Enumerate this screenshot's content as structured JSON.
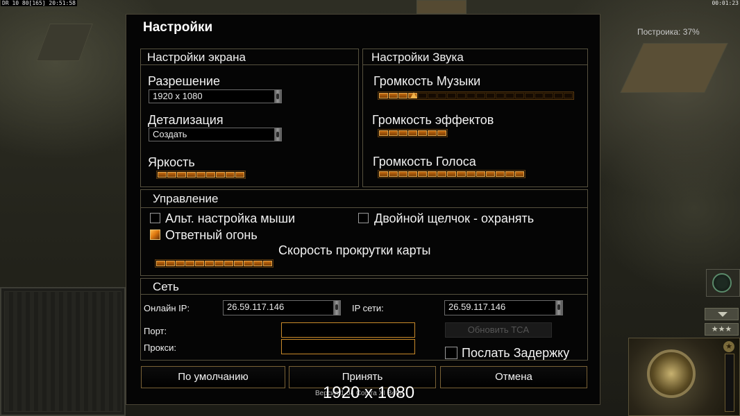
{
  "hud": {
    "top_left": "DR 10 80[165] 20:51:58",
    "top_right": "00:01:23",
    "fps_badge": "Построика: 37%"
  },
  "dialog": {
    "title": "Настройки",
    "display": {
      "title": "Настройки экрана",
      "resolution_label": "Разрешение",
      "resolution_value": "1920 x 1080",
      "detail_label": "Детализация",
      "detail_value": "Создать",
      "brightness_label": "Яркость",
      "brightness_level": 9,
      "brightness_total": 9
    },
    "sound": {
      "title": "Настройки Звука",
      "music_label": "Громкость Музыки",
      "music_level": 4,
      "music_total": 20,
      "effects_label": "Громкость эффектов",
      "effects_level": 7,
      "effects_total": 7,
      "voice_label": "Громкость Голоса",
      "voice_level": 15,
      "voice_total": 15
    },
    "controls": {
      "title": "Управление",
      "alt_mouse_label": "Альт. настройка мыши",
      "alt_mouse_checked": false,
      "double_click_label": "Двойной щелчок - охранять",
      "double_click_checked": false,
      "return_fire_label": "Ответный огонь",
      "return_fire_checked": true,
      "scroll_speed_label": "Скорость прокрутки карты",
      "scroll_level": 12,
      "scroll_total": 12
    },
    "network": {
      "title": "Сеть",
      "online_ip_label": "Онлайн IP:",
      "online_ip_value": "26.59.117.146",
      "lan_ip_label": "IP сети:",
      "lan_ip_value": "26.59.117.146",
      "port_label": "Порт:",
      "proxy_label": "Прокси:",
      "update_button": "Обновить TCA",
      "send_delay_label": "Послать Задержку",
      "send_delay_checked": false
    },
    "buttons": {
      "defaults": "По умолчанию",
      "accept": "Принять",
      "cancel": "Отмена"
    },
    "footer_version": "Версия 1.04 Contra XI Beta",
    "footer_resolution": "1920 x 1080"
  },
  "colors": {
    "accent": "#e07a10",
    "frame": "#57523f",
    "background": "#050505"
  }
}
